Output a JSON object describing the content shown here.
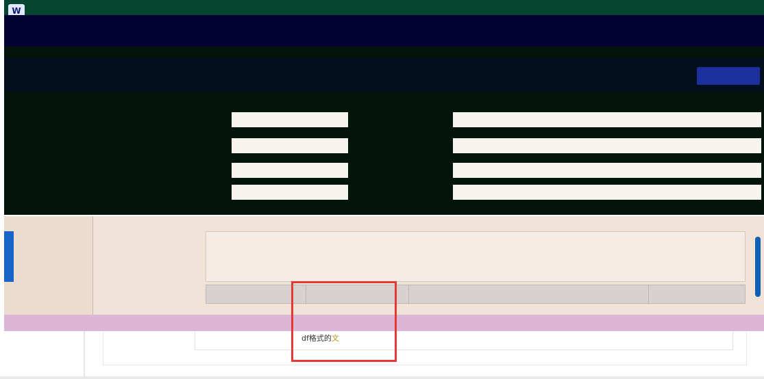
{
  "window": {
    "logo_text": "W",
    "title": "",
    "right_text": ""
  },
  "nav": {
    "row1": "",
    "row2_a": "",
    "row2_b": ""
  },
  "header": {
    "label": "",
    "value": "",
    "action_button": ""
  },
  "form": {
    "rows": [
      {
        "label": "",
        "value": "",
        "label2": "",
        "value2": ""
      },
      {
        "label": "",
        "value": "",
        "label2": "",
        "value2": ""
      },
      {
        "label": "",
        "value": "",
        "label2": "",
        "value2": ""
      },
      {
        "label": "",
        "value": "",
        "label2": "",
        "value2": ""
      }
    ]
  },
  "lower": {
    "textarea_label": "",
    "textarea_count": "",
    "table_label": "",
    "table": {
      "columns": [
        "",
        "",
        "",
        ""
      ],
      "rows": [
        [
          "",
          "",
          "",
          ""
        ]
      ]
    }
  },
  "tooltip": {
    "prefix": "df格式的",
    "highlight": "文"
  },
  "colors": {
    "titlebar": "#06452f",
    "nav": "#030235",
    "accent": "#1766c7",
    "row_highlight": "#dcb6d6",
    "selection_box": "#e53935"
  }
}
